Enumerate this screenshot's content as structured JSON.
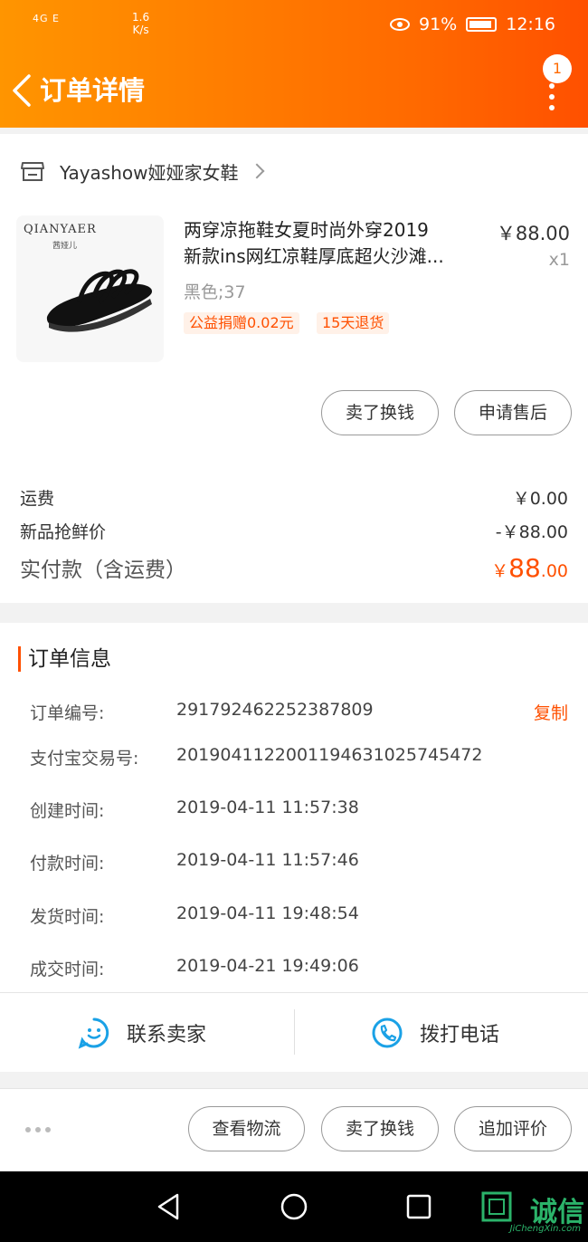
{
  "status_bar": {
    "signal": "4G  E",
    "speed_value": "1.6",
    "speed_unit": "K/s",
    "battery": "91%",
    "time": "12:16"
  },
  "nav": {
    "title": "订单详情",
    "badge": "1"
  },
  "shop": {
    "name": "Yayashow娅娅家女鞋"
  },
  "product": {
    "brand": "QIANYAER",
    "brand_sub": "茜娅儿",
    "title_line1": "两穿凉拖鞋女夏时尚外穿2019",
    "title_line2": "新款ins网红凉鞋厚底超火沙滩...",
    "price": "￥88.00",
    "qty": "x1",
    "sku": "黑色;37",
    "tags": [
      "公益捐赠0.02元",
      "15天退货"
    ]
  },
  "item_actions": [
    "卖了换钱",
    "申请售后"
  ],
  "fees": {
    "shipping_label": "运费",
    "shipping_value": "￥0.00",
    "discount_label": "新品抢鲜价",
    "discount_value": "-￥88.00",
    "total_label": "实付款（含运费）",
    "total_currency": "￥",
    "total_int": "88",
    "total_dec": ".00"
  },
  "order_info": {
    "title": "订单信息",
    "copy_label": "复制",
    "rows": [
      {
        "label": "订单编号:",
        "value": "291792462252387809"
      },
      {
        "label": "支付宝交易号:",
        "value": "2019041122001194631025745472"
      },
      {
        "label": "创建时间:",
        "value": "2019-04-11 11:57:38"
      },
      {
        "label": "付款时间:",
        "value": "2019-04-11 11:57:46"
      },
      {
        "label": "发货时间:",
        "value": "2019-04-11 19:48:54"
      },
      {
        "label": "成交时间:",
        "value": "2019-04-21 19:49:06"
      }
    ]
  },
  "contact": {
    "seller": "联系卖家",
    "phone": "拨打电话"
  },
  "bottom_actions": [
    "查看物流",
    "卖了换钱",
    "追加评价"
  ],
  "watermark": {
    "text": "诚信",
    "sub": "JiChengXin.com"
  },
  "colors": {
    "accent": "#ff5000",
    "header_start": "#ff9500",
    "header_end": "#ff5000",
    "icon_blue": "#1aa1e6"
  }
}
